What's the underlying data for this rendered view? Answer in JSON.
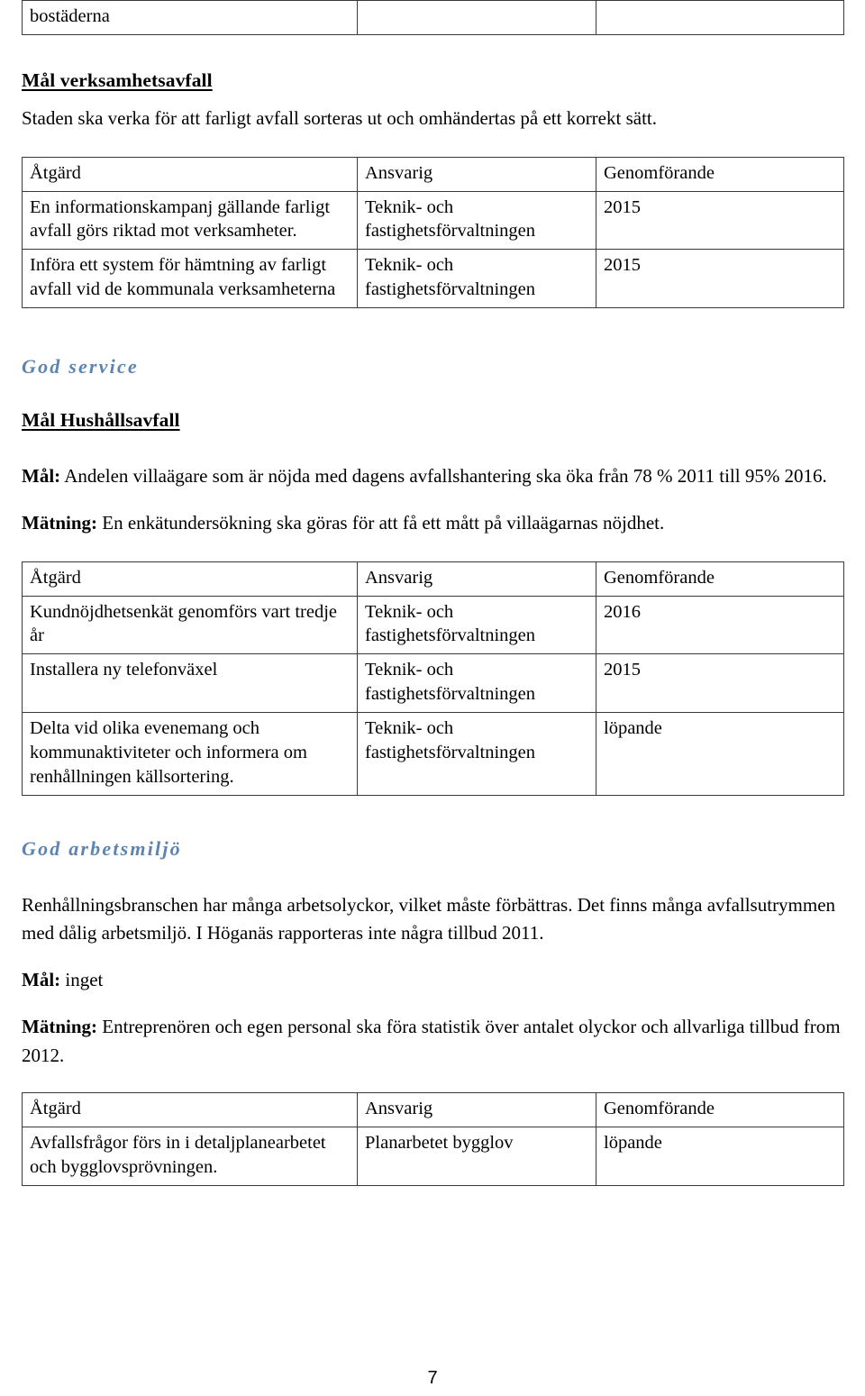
{
  "document": {
    "page_number": "7",
    "accent_color": "#5d84b1",
    "border_color": "#3a3a3a"
  },
  "continued_table": {
    "rows": [
      {
        "atgard": "bostäderna",
        "ansvarig": "",
        "genomforande": ""
      }
    ]
  },
  "section_verksamhetsavfall": {
    "heading": "Mål verksamhetsavfall",
    "intro": "Staden ska verka för att farligt avfall sorteras ut och omhändertas på ett korrekt sätt.",
    "table": {
      "headers": {
        "atgard": "Åtgärd",
        "ansvarig": "Ansvarig",
        "genomforande": "Genomförande"
      },
      "rows": [
        {
          "atgard": "En informationskampanj gällande farligt avfall görs riktad mot verksamheter.",
          "ansvarig": "Teknik- och fastighetsförvaltningen",
          "genomforande": "2015"
        },
        {
          "atgard": "Införa ett system för hämtning av farligt avfall vid de kommunala verksamheterna",
          "ansvarig": "Teknik- och fastighetsförvaltningen",
          "genomforande": "2015"
        }
      ]
    }
  },
  "section_god_service": {
    "section_title": "God service",
    "heading": "Mål Hushållsavfall",
    "mal_label": "Mål:",
    "mal_text": " Andelen villaägare som är nöjda med dagens avfallshantering ska öka från 78 % 2011 till 95% 2016.",
    "matning_label": "Mätning:",
    "matning_text": " En enkätundersökning ska göras för att få ett mått på villaägarnas nöjdhet.",
    "table": {
      "headers": {
        "atgard": "Åtgärd",
        "ansvarig": "Ansvarig",
        "genomforande": "Genomförande"
      },
      "rows": [
        {
          "atgard": "Kundnöjdhetsenkät genomförs vart tredje år",
          "ansvarig": "Teknik- och fastighetsförvaltningen",
          "genomforande": "2016"
        },
        {
          "atgard": "Installera ny telefonväxel",
          "ansvarig": "Teknik- och fastighetsförvaltningen",
          "genomforande": "2015"
        },
        {
          "atgard": "Delta vid olika evenemang och kommunaktiviteter och informera om renhållningen källsortering.",
          "ansvarig": "Teknik- och fastighetsförvaltningen",
          "genomforande": "löpande"
        }
      ]
    }
  },
  "section_god_arbetsmiljo": {
    "section_title": "God arbetsmiljö",
    "paragraph": "Renhållningsbranschen har många arbetsolyckor, vilket måste förbättras. Det finns många avfallsutrymmen med dålig arbetsmiljö. I Höganäs rapporteras inte några tillbud 2011.",
    "mal_label": "Mål:",
    "mal_text": " inget",
    "matning_label": "Mätning:",
    "matning_text": " Entreprenören och egen personal ska föra statistik över antalet olyckor och allvarliga tillbud from 2012.",
    "table": {
      "headers": {
        "atgard": "Åtgärd",
        "ansvarig": "Ansvarig",
        "genomforande": "Genomförande"
      },
      "rows": [
        {
          "atgard": "Avfallsfrågor förs in i detaljplanearbetet och bygglovsprövningen.",
          "ansvarig": "Planarbetet bygglov",
          "genomforande": "löpande"
        }
      ]
    }
  }
}
